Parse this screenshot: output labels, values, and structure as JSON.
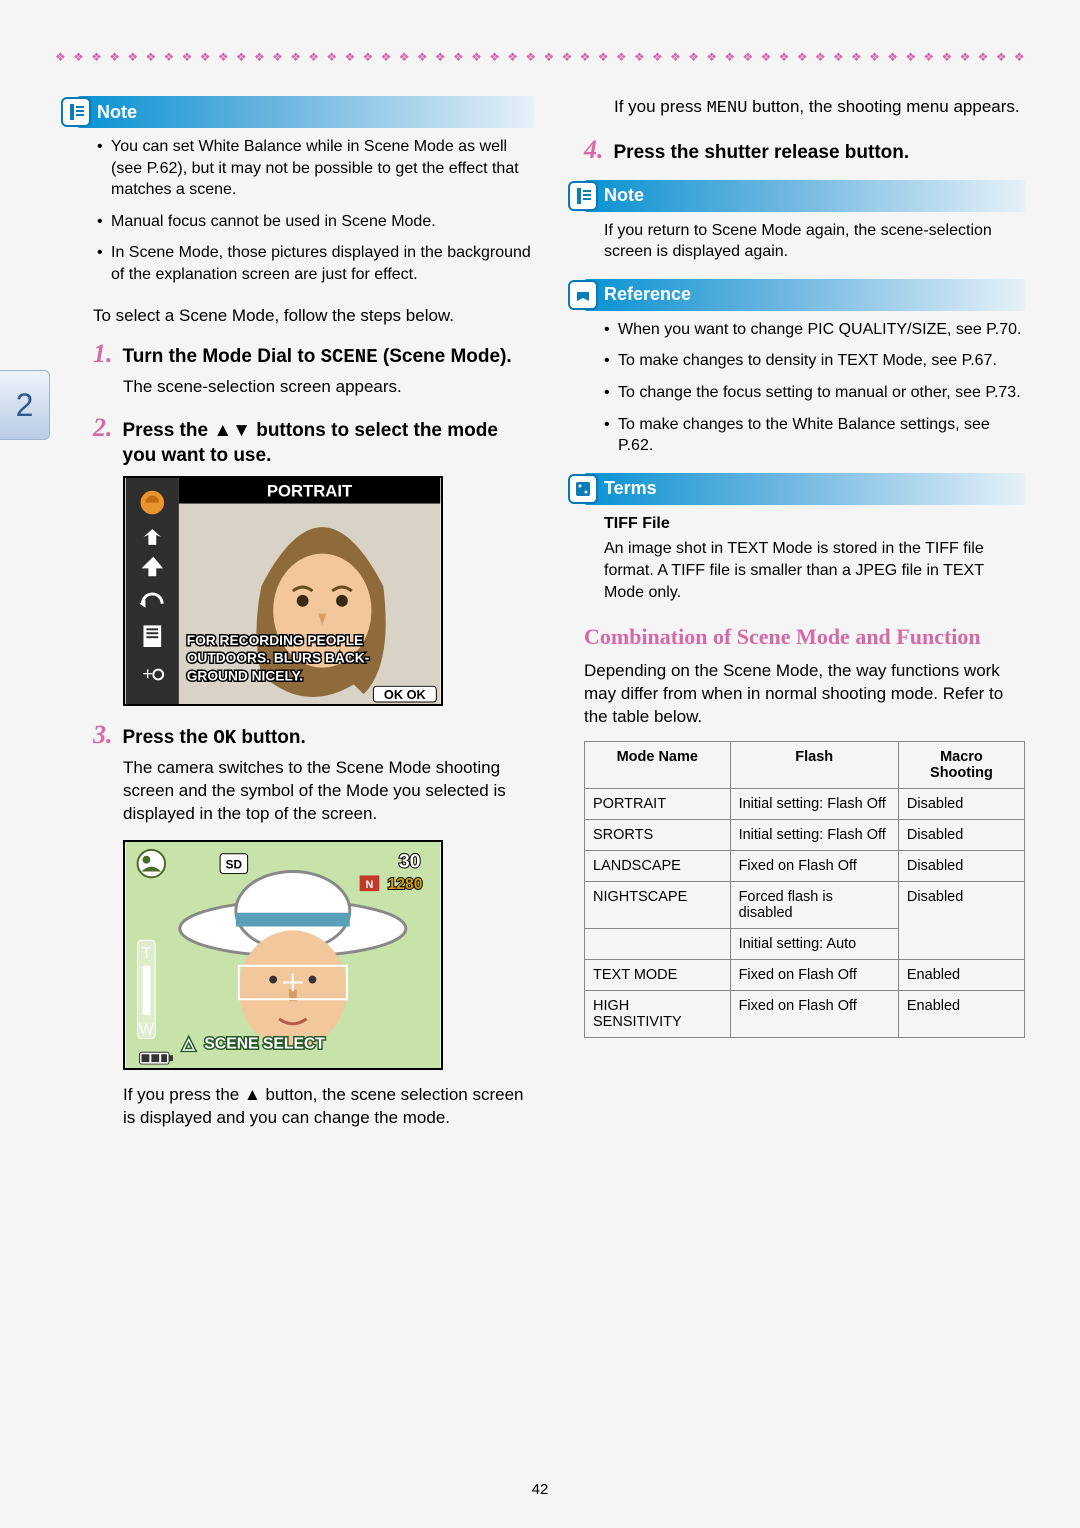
{
  "decor_diamonds": "❖ ❖ ❖ ❖ ❖ ❖ ❖ ❖ ❖ ❖ ❖ ❖ ❖ ❖ ❖ ❖ ❖ ❖ ❖ ❖ ❖ ❖ ❖ ❖ ❖ ❖ ❖ ❖ ❖ ❖ ❖ ❖ ❖ ❖ ❖ ❖ ❖ ❖ ❖ ❖ ❖ ❖ ❖ ❖ ❖ ❖ ❖ ❖ ❖ ❖ ❖ ❖ ❖ ❖ ❖ ❖",
  "chapter_tab": "2",
  "page_number": "42",
  "left": {
    "note": {
      "label": "Note",
      "items": [
        "You can set White Balance while in Scene Mode as well (see P.62), but it may not be possible to get the effect that matches a scene.",
        "Manual focus cannot be used in Scene Mode.",
        "In Scene Mode, those pictures displayed in the background of the explanation screen are just for effect."
      ]
    },
    "lead": "To select a Scene Mode, follow the steps below.",
    "steps": {
      "s1": {
        "num": "1.",
        "title_before": "Turn the Mode Dial to ",
        "title_mono": "SCENE",
        "title_after": " (Scene Mode).",
        "body": "The scene-selection screen appears."
      },
      "s2": {
        "num": "2.",
        "title": "Press the ▲▼ buttons to select the mode you want to use."
      },
      "s3": {
        "num": "3.",
        "title_before": "Press the ",
        "title_mono": "OK",
        "title_after": " button.",
        "body": "The camera switches to the Scene Mode shooting screen and the symbol of the Mode you selected is displayed in the top of the screen.",
        "after1": "If you press the ▲ button, the scene selection screen is displayed and you can change the mode.",
        "after2_a": "If you press ",
        "after2_mono": "MENU",
        "after2_b": " button, the shooting menu appears."
      },
      "s4": {
        "num": "4.",
        "title": "Press the shutter release button."
      }
    },
    "illus1": {
      "title": "PORTRAIT",
      "desc1": "FOR RECORDING PEOPLE",
      "desc2": "OUTDOORS. BLURS BACK-",
      "desc3": "GROUND NICELY.",
      "ok": "OK OK"
    },
    "illus2": {
      "badge1": "SD",
      "badge2": "30",
      "badge3": "1280",
      "label": "SCENE SELECT"
    }
  },
  "right": {
    "note": {
      "label": "Note",
      "body": "If you return to Scene Mode again, the scene-selection screen is displayed again."
    },
    "reference": {
      "label": "Reference",
      "items": [
        "When you want to change PIC QUALITY/SIZE, see P.70.",
        "To make changes to density in TEXT Mode, see P.67.",
        "To change the focus setting to manual or other, see P.73.",
        "To make changes to the White Balance settings, see P.62."
      ]
    },
    "terms": {
      "label": "Terms",
      "sub": "TIFF File",
      "body": "An image shot in TEXT Mode is stored in the TIFF file format. A TIFF file is smaller than a JPEG file in TEXT Mode only."
    },
    "section_title": "Combination of Scene Mode and Function",
    "section_body": "Depending on the Scene Mode, the way functions work may differ from when in normal shooting mode. Refer to the table below.",
    "table": {
      "headers": {
        "h1": "Mode Name",
        "h2": "Flash",
        "h3": "Macro Shooting"
      },
      "rows": [
        {
          "c1": "PORTRAIT",
          "c2": "Initial setting: Flash Off",
          "c3": "Disabled"
        },
        {
          "c1": "SRORTS",
          "c2": "Initial setting: Flash Off",
          "c3": "Disabled"
        },
        {
          "c1": "LANDSCAPE",
          "c2": "Fixed on Flash Off",
          "c3": "Disabled"
        },
        {
          "c1": "NIGHTSCAPE",
          "c2": "Forced flash is disabled",
          "c3": "Disabled"
        },
        {
          "c1": "",
          "c2": "Initial setting: Auto",
          "c3": ""
        },
        {
          "c1": "TEXT MODE",
          "c2": "Fixed on Flash Off",
          "c3": "Enabled"
        },
        {
          "c1": "HIGH SENSITIVITY",
          "c2": "Fixed on Flash Off",
          "c3": "Enabled"
        }
      ]
    }
  }
}
